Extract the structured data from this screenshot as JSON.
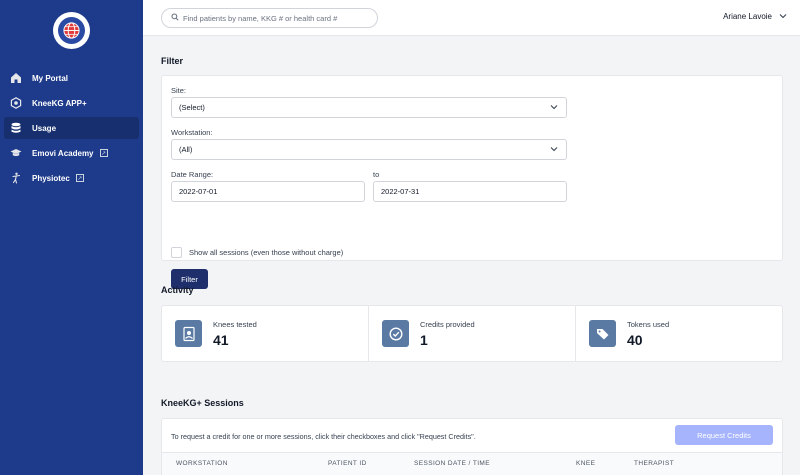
{
  "sidebar": {
    "items": [
      {
        "label": "My Portal",
        "icon": "home-icon"
      },
      {
        "label": "KneeKG APP+",
        "icon": "hexagon-icon"
      },
      {
        "label": "Usage",
        "icon": "database-icon",
        "active": true
      },
      {
        "label": "Emovi Academy",
        "icon": "graduation-cap-icon",
        "external": true
      },
      {
        "label": "Physiotec",
        "icon": "figure-icon",
        "external": true
      }
    ]
  },
  "topbar": {
    "search_placeholder": "Find patients by name, KKG # or health card #",
    "user_name": "Ariane Lavoie"
  },
  "filter": {
    "title": "Filter",
    "site_label": "Site:",
    "site_value": "(Select)",
    "workstation_label": "Workstation:",
    "workstation_value": "(All)",
    "date_range_label": "Date Range:",
    "date_from": "2022-07-01",
    "to_label": "to",
    "date_to": "2022-07-31",
    "show_all_label": "Show all sessions (even those without charge)",
    "filter_button": "Filter"
  },
  "activity": {
    "title": "Activity",
    "stats": [
      {
        "label": "Knees tested",
        "value": "41",
        "icon": "knee-test-icon"
      },
      {
        "label": "Credits provided",
        "value": "1",
        "icon": "check-circle-icon"
      },
      {
        "label": "Tokens used",
        "value": "40",
        "icon": "tags-icon"
      }
    ]
  },
  "sessions": {
    "title": "KneeKG+ Sessions",
    "note": "To request a credit for one or more sessions, click their checkboxes and click \"Request Credits\".",
    "request_button": "Request Credits",
    "columns": [
      "WORKSTATION",
      "PATIENT ID",
      "SESSION DATE / TIME",
      "KNEE",
      "THERAPIST"
    ]
  },
  "colors": {
    "sidebar_bg": "#1e3a8a",
    "primary_button": "#1e2f6b",
    "disabled_button": "#a5b4fc",
    "stat_icon_bg": "#5a7aa3"
  }
}
